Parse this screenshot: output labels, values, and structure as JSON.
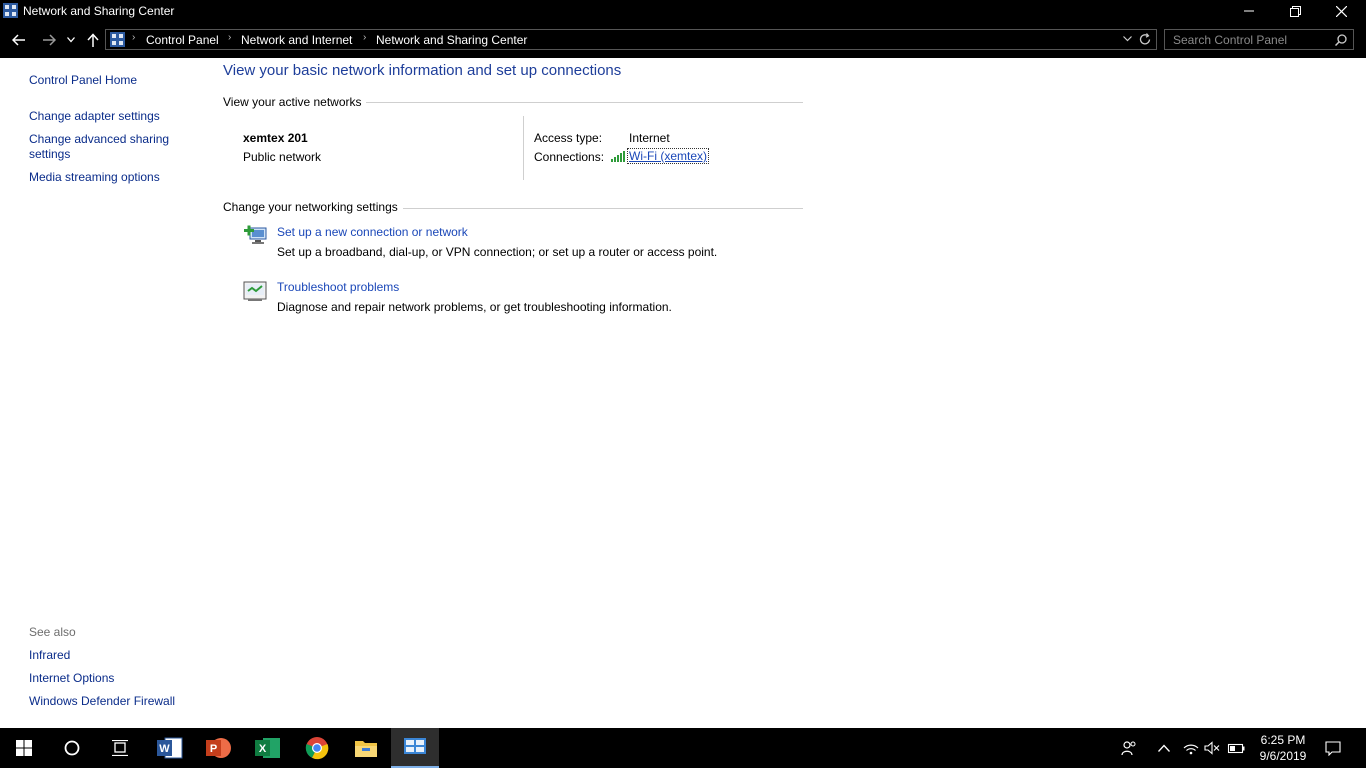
{
  "window": {
    "title": "Network and Sharing Center"
  },
  "address_bar": {
    "breadcrumbs": [
      "Control Panel",
      "Network and Internet",
      "Network and Sharing Center"
    ],
    "search_placeholder": "Search Control Panel"
  },
  "left_pane": {
    "links": [
      "Control Panel Home",
      "Change adapter settings",
      "Change advanced sharing",
      "settings",
      "Media streaming options"
    ],
    "see_also_title": "See also",
    "see_also": [
      "Infrared",
      "Internet Options",
      "Windows Defender Firewall"
    ]
  },
  "main": {
    "heading": "View your basic network information and set up connections",
    "active_networks_title": "View your active networks",
    "network": {
      "name": "xemtex 201",
      "category": "Public network",
      "access_type_label": "Access type:",
      "access_type_value": "Internet",
      "connections_label": "Connections:",
      "connection_value": "Wi-Fi (xemtex)"
    },
    "change_settings_title": "Change your networking settings",
    "tasks": [
      {
        "title": "Set up a new connection or network",
        "desc": "Set up a broadband, dial-up, or VPN connection; or set up a router or access point.",
        "icon": "new-connection-icon"
      },
      {
        "title": "Troubleshoot problems",
        "desc": "Diagnose and repair network problems, or get troubleshooting information.",
        "icon": "troubleshoot-icon"
      }
    ]
  },
  "taskbar": {
    "time": "6:25 PM",
    "date": "9/6/2019",
    "apps": [
      "start-icon",
      "cortana-icon",
      "task-view-icon",
      "word-icon",
      "powerpoint-icon",
      "excel-icon",
      "chrome-icon",
      "file-explorer-icon",
      "control-panel-icon"
    ]
  }
}
